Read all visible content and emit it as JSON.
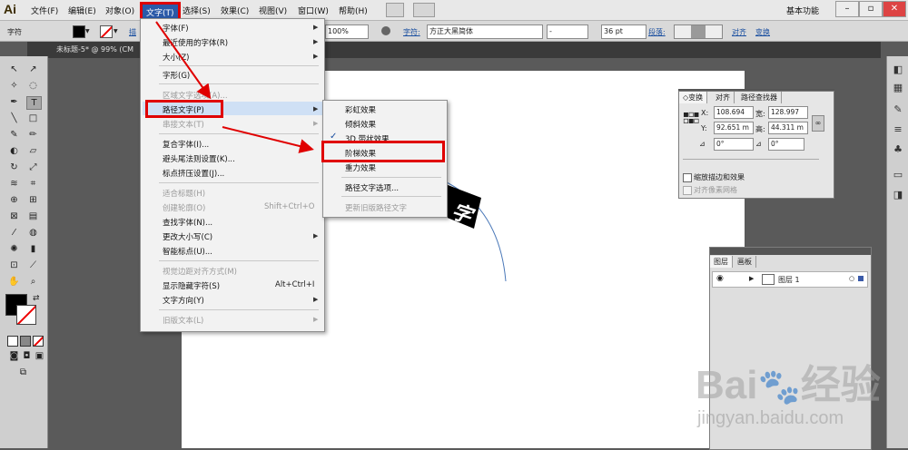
{
  "app": {
    "logo": "Ai",
    "workspace": "基本功能"
  },
  "menubar": {
    "items": [
      "文件(F)",
      "编辑(E)",
      "对象(O)",
      "文字(T)",
      "选择(S)",
      "效果(C)",
      "视图(V)",
      "窗口(W)",
      "帮助(H)"
    ]
  },
  "controlbar": {
    "panel_label": "字符",
    "stroke_label": "描",
    "zoom_value": "100%",
    "char_label": "字符:",
    "font_name": "方正大黑简体",
    "font_style": "-",
    "font_size": "36 pt",
    "para_label": "段落:",
    "align_label": "对齐",
    "transform_label": "变换"
  },
  "document": {
    "tab_title": "未标题-5* @ 99% (CM"
  },
  "type_menu": {
    "items": [
      {
        "label": "字体(F)",
        "submenu": true,
        "disabled": false
      },
      {
        "label": "最近使用的字体(R)",
        "submenu": true,
        "disabled": false
      },
      {
        "label": "大小(Z)",
        "submenu": true,
        "disabled": false
      },
      {
        "label": "字形(G)",
        "submenu": false,
        "disabled": false
      },
      {
        "label": "区域文字选项(A)...",
        "submenu": false,
        "disabled": true
      },
      {
        "label": "路径文字(P)",
        "submenu": true,
        "disabled": false,
        "highlighted": true
      },
      {
        "label": "串接文本(T)",
        "submenu": true,
        "disabled": true
      },
      {
        "label": "复合字体(I)...",
        "submenu": false,
        "disabled": false
      },
      {
        "label": "避头尾法则设置(K)...",
        "submenu": false,
        "disabled": false
      },
      {
        "label": "标点挤压设置(J)...",
        "submenu": false,
        "disabled": false
      },
      {
        "label": "适合标题(H)",
        "submenu": false,
        "disabled": true
      },
      {
        "label": "创建轮廓(O)",
        "shortcut": "Shift+Ctrl+O",
        "submenu": false,
        "disabled": true
      },
      {
        "label": "查找字体(N)...",
        "submenu": false,
        "disabled": false
      },
      {
        "label": "更改大小写(C)",
        "submenu": true,
        "disabled": false
      },
      {
        "label": "智能标点(U)...",
        "submenu": false,
        "disabled": false
      },
      {
        "label": "视觉边距对齐方式(M)",
        "submenu": false,
        "disabled": true
      },
      {
        "label": "显示隐藏字符(S)",
        "shortcut": "Alt+Ctrl+I",
        "submenu": false,
        "disabled": false
      },
      {
        "label": "文字方向(Y)",
        "submenu": true,
        "disabled": false
      },
      {
        "label": "旧版文本(L)",
        "submenu": true,
        "disabled": true
      }
    ]
  },
  "path_type_submenu": {
    "items": [
      {
        "label": "彩虹效果",
        "checked": false,
        "disabled": false
      },
      {
        "label": "倾斜效果",
        "checked": false,
        "disabled": false
      },
      {
        "label": "3D 带状效果",
        "checked": true,
        "disabled": false
      },
      {
        "label": "阶梯效果",
        "checked": false,
        "disabled": false,
        "highlighted": true
      },
      {
        "label": "重力效果",
        "checked": false,
        "disabled": false
      },
      {
        "label": "路径文字选项...",
        "checked": false,
        "disabled": false
      },
      {
        "label": "更新旧版路径文字",
        "checked": false,
        "disabled": true
      }
    ]
  },
  "canvas": {
    "text_on_path": "字"
  },
  "transform_panel": {
    "tabs": [
      "◇变换",
      "对齐",
      "路径查找器"
    ],
    "x_label": "X:",
    "x_value": "108.694",
    "y_label": "Y:",
    "y_value": "92.651 m",
    "w_label": "宽:",
    "w_value": "128.997",
    "h_label": "高:",
    "h_value": "44.311 m",
    "rotate_value": "0°",
    "shear_value": "0°",
    "scale_strokes_label": "缩放描边和效果",
    "align_pixel_label": "对齐像素网格"
  },
  "layers_panel": {
    "tabs": [
      "图层",
      "画板"
    ],
    "layer_name": "图层 1"
  },
  "watermark": {
    "brand": "Bai",
    "brand2": "经验",
    "url": "jingyan.baidu.com"
  },
  "colors": {
    "highlight": "#2b5aa8",
    "annotation_red": "#e00000"
  }
}
